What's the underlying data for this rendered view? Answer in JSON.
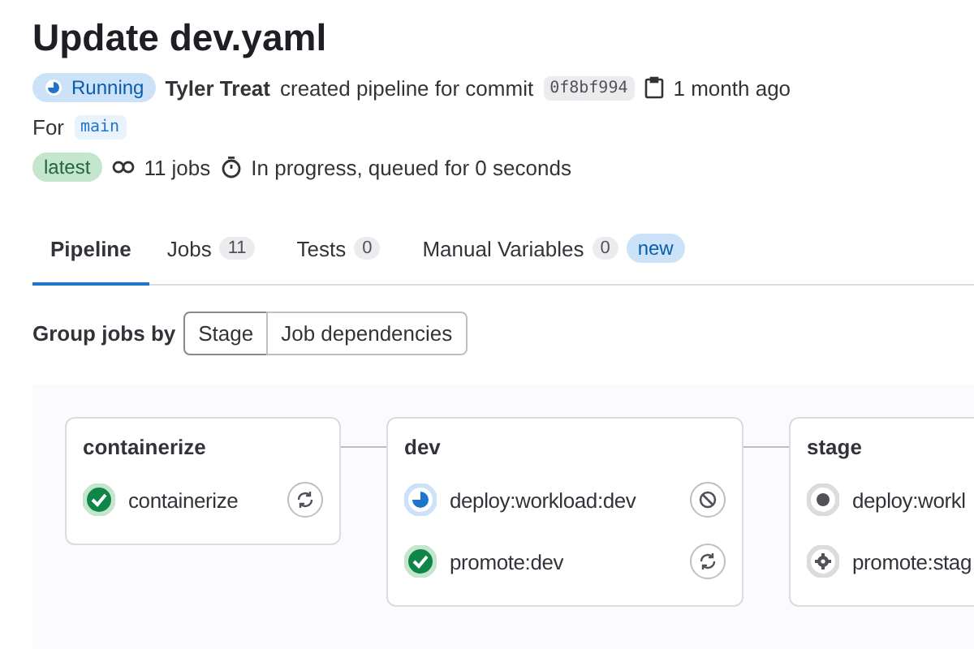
{
  "title": "Update dev.yaml",
  "status": {
    "kind": "running",
    "label": "Running"
  },
  "author": "Tyler Treat",
  "action_text": "created pipeline for commit",
  "commit": "0f8bf994",
  "time": "1 month ago",
  "ref_label": "For",
  "ref": "main",
  "badge": "latest",
  "jobs_count": "11 jobs",
  "duration": "In progress, queued for 0 seconds",
  "tabs": [
    {
      "label": "Pipeline",
      "selected": true
    },
    {
      "label": "Jobs",
      "count": "11",
      "selected": false
    },
    {
      "label": "Tests",
      "count": "0",
      "selected": false
    },
    {
      "label": "Manual Variables",
      "count": "0",
      "tag": "new",
      "selected": false
    }
  ],
  "group_by": {
    "label": "Group jobs by",
    "options": [
      {
        "label": "Stage",
        "selected": true
      },
      {
        "label": "Job dependencies",
        "selected": false
      }
    ]
  },
  "stages": [
    {
      "name": "containerize",
      "jobs": [
        {
          "name": "containerize",
          "kind": "success",
          "action": {
            "kind": "retry"
          }
        }
      ]
    },
    {
      "name": "dev",
      "jobs": [
        {
          "name": "deploy:workload:dev",
          "kind": "running",
          "action": {
            "kind": "cancel"
          }
        },
        {
          "name": "promote:dev",
          "kind": "success",
          "action": {
            "kind": "retry"
          }
        }
      ]
    },
    {
      "name": "stage",
      "jobs": [
        {
          "name": "deploy:workl",
          "kind": "created"
        },
        {
          "name": "promote:stag",
          "kind": "manual"
        }
      ]
    }
  ]
}
